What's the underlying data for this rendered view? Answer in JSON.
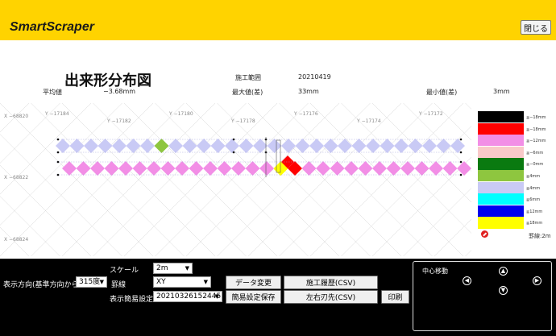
{
  "header": {
    "app_title": "SmartScraper",
    "close_label": "閉じる"
  },
  "report": {
    "title": "出来形分布図",
    "range_label": "施工範囲",
    "range_value": "20210419",
    "avg_label": "平均値",
    "avg_value": "−3.68mm",
    "max_label": "最大値(差)",
    "max_value": "33mm",
    "min_label": "最小値(差)",
    "min_value": "3mm"
  },
  "plot": {
    "y_labels": [
      "Y −17184",
      "Y −17182",
      "Y −17180",
      "Y −17178",
      "Y −17176",
      "Y −17174",
      "Y −17172"
    ],
    "x_labels": [
      "X −68820",
      "X −68822",
      "X −68824"
    ],
    "colors": {
      "lavender": "#c9caf5",
      "pink": "#f28ee6",
      "green": "#8ec63f",
      "red": "#ff0000",
      "yellow": "#ffff00",
      "grid": "#d6d6d6"
    },
    "row1_highlight_green_index": 7,
    "row2_highlight_red_index": 16,
    "row2_highlight_yellow_index": 15
  },
  "legend": {
    "items": [
      {
        "color": "#000000",
        "label": "≦−18mm"
      },
      {
        "color": "#ff0000",
        "label": "≦−18mm"
      },
      {
        "color": "#f28ee6",
        "label": "≦−12mm"
      },
      {
        "color": "#f9c9c9",
        "label": "≦−6mm"
      },
      {
        "color": "#0a7a10",
        "label": "≧−0mm"
      },
      {
        "color": "#8ec63f",
        "label": "≧4mm"
      },
      {
        "color": "#c9caf5",
        "label": "≧4mm"
      },
      {
        "color": "#00ffff",
        "label": "≧6mm"
      },
      {
        "color": "#0000ee",
        "label": "≧12mm"
      },
      {
        "color": "#ffff00",
        "label": "≧18mm"
      }
    ],
    "scale_label": "罫線:2m",
    "marker_icon": "no-entry-icon"
  },
  "controls": {
    "scale_label": "スケール",
    "scale_value": "2m",
    "direction_label": "表示方向(基準方向から)",
    "direction_value": "315度",
    "grid_label": "罫線",
    "grid_value": "XY",
    "preset_label": "表示簡易設定",
    "preset_value": "20210326152445",
    "data_change": "データ変更",
    "history_csv": "施工履歴(CSV)",
    "save_preset": "簡易設定保存",
    "edge_csv": "左右刃先(CSV)",
    "print": "印刷",
    "center_move": "中心移動"
  }
}
